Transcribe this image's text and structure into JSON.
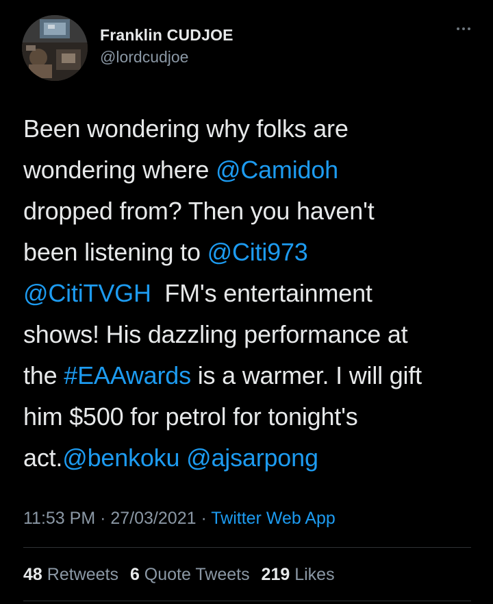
{
  "user": {
    "display_name": "Franklin CUDJOE",
    "handle": "@lordcudjoe"
  },
  "tweet": {
    "lines": [
      [
        {
          "t": "Been wondering why folks are",
          "link": false
        }
      ],
      [
        {
          "t": "wondering where ",
          "link": false
        },
        {
          "t": "@Camidoh",
          "link": true
        }
      ],
      [
        {
          "t": "dropped from? Then you haven't",
          "link": false
        }
      ],
      [
        {
          "t": "been listening to ",
          "link": false
        },
        {
          "t": "@Citi973",
          "link": true
        }
      ],
      [
        {
          "t": "@CitiTVGH",
          "link": true
        },
        {
          "t": "  FM's entertainment",
          "link": false
        }
      ],
      [
        {
          "t": "shows! His dazzling performance at",
          "link": false
        }
      ],
      [
        {
          "t": "the ",
          "link": false
        },
        {
          "t": "#EAAwards",
          "link": true
        },
        {
          "t": " is a warmer. I will gift",
          "link": false
        }
      ],
      [
        {
          "t": "him $500 for petrol for tonight's",
          "link": false
        }
      ],
      [
        {
          "t": "act.",
          "link": false
        },
        {
          "t": "@benkoku",
          "link": true
        },
        {
          "t": " ",
          "link": false
        },
        {
          "t": "@ajsarpong",
          "link": true
        }
      ]
    ]
  },
  "meta": {
    "time": "11:53 PM",
    "separator1": " · ",
    "date": "27/03/2021",
    "separator2": " · ",
    "source": "Twitter Web App"
  },
  "stats": {
    "retweets_count": "48",
    "retweets_label": "Retweets",
    "quotes_count": "6",
    "quotes_label": "Quote Tweets",
    "likes_count": "219",
    "likes_label": "Likes"
  },
  "colors": {
    "background": "#000000",
    "text": "#e7e9ea",
    "secondary": "#8b98a5",
    "link": "#1d9bf0",
    "divider": "#2f3336"
  },
  "icons": {
    "more": "more-horizontal-icon",
    "avatar": "profile-photo"
  }
}
